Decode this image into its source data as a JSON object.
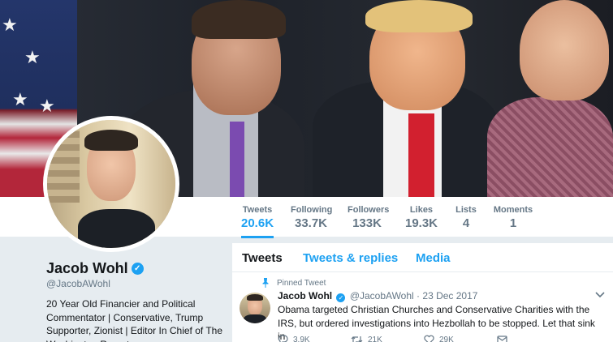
{
  "profile": {
    "name": "Jacob Wohl",
    "handle": "@JacobAWohl",
    "bio": "20 Year Old Financier and Political Commentator | Conservative, Trump Supporter, Zionist | Editor In Chief of The Washington Reporter"
  },
  "stats": [
    {
      "label": "Tweets",
      "value": "20.6K",
      "active": true
    },
    {
      "label": "Following",
      "value": "33.7K"
    },
    {
      "label": "Followers",
      "value": "133K"
    },
    {
      "label": "Likes",
      "value": "19.3K"
    },
    {
      "label": "Lists",
      "value": "4"
    },
    {
      "label": "Moments",
      "value": "1"
    }
  ],
  "tabs": [
    "Tweets",
    "Tweets & replies",
    "Media"
  ],
  "tweet": {
    "pinned_label": "Pinned Tweet",
    "name": "Jacob Wohl",
    "handle": "@JacobAWohl",
    "separator": "·",
    "date": "23 Dec 2017",
    "text": "Obama targeted Christian Churches and Conservative Charities with the IRS, but ordered investigations into Hezbollah to be stopped. Let that sink in",
    "replies": "3.9K",
    "retweets": "21K",
    "likes": "29K"
  },
  "colors": {
    "accent": "#1da1f2",
    "secondary_text": "#657786",
    "background": "#e6ecf0"
  },
  "icons": [
    "verified-badge-icon",
    "pin-icon",
    "chevron-down-icon",
    "reply-icon",
    "retweet-icon",
    "like-icon",
    "message-icon"
  ]
}
